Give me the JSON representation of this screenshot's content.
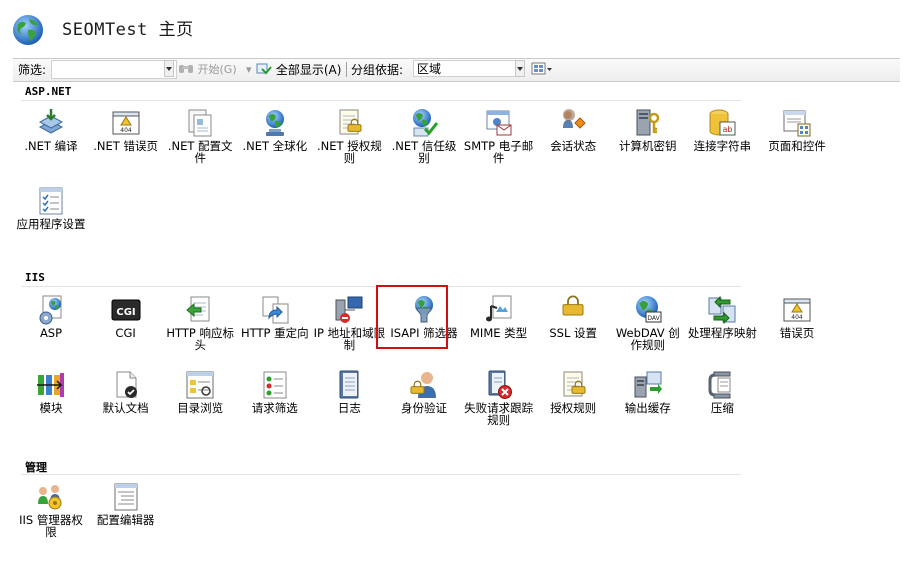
{
  "header": {
    "title": "SEOMTest 主页"
  },
  "toolbar": {
    "filter_label": "筛选:",
    "start_label": "开始(G)",
    "show_all_label": "全部显示(A)",
    "group_by_label": "分组依据:",
    "group_by_value": "区域"
  },
  "sections": [
    {
      "title": "ASP.NET",
      "items": [
        {
          "label": ".NET 编译",
          "icon": "compile-icon"
        },
        {
          "label": ".NET 错误页",
          "icon": "error-page-icon"
        },
        {
          "label": ".NET 配置文件",
          "icon": "profile-icon"
        },
        {
          "label": ".NET 全球化",
          "icon": "globalization-icon"
        },
        {
          "label": ".NET 授权规则",
          "icon": "authorization-icon"
        },
        {
          "label": ".NET 信任级别",
          "icon": "trust-level-icon"
        },
        {
          "label": "SMTP 电子邮件",
          "icon": "email-icon"
        },
        {
          "label": "会话状态",
          "icon": "session-state-icon"
        },
        {
          "label": "计算机密钥",
          "icon": "machine-key-icon"
        },
        {
          "label": "连接字符串",
          "icon": "connection-string-icon"
        },
        {
          "label": "页面和控件",
          "icon": "pages-controls-icon"
        },
        {
          "label": "应用程序设置",
          "icon": "app-settings-icon"
        }
      ]
    },
    {
      "title": "IIS",
      "items": [
        {
          "label": "ASP",
          "icon": "asp-icon"
        },
        {
          "label": "CGI",
          "icon": "cgi-icon"
        },
        {
          "label": "HTTP 响应标头",
          "icon": "response-headers-icon"
        },
        {
          "label": "HTTP 重定向",
          "icon": "redirect-icon"
        },
        {
          "label": "IP 地址和域限制",
          "icon": "ip-restrictions-icon"
        },
        {
          "label": "ISAPI 筛选器",
          "icon": "isapi-filter-icon"
        },
        {
          "label": "MIME 类型",
          "icon": "mime-types-icon"
        },
        {
          "label": "SSL 设置",
          "icon": "ssl-lock-icon"
        },
        {
          "label": "WebDAV 创作规则",
          "icon": "webdav-icon"
        },
        {
          "label": "处理程序映射",
          "icon": "handler-mappings-icon"
        },
        {
          "label": "错误页",
          "icon": "error-page-icon"
        },
        {
          "label": "模块",
          "icon": "modules-icon"
        },
        {
          "label": "默认文档",
          "icon": "default-document-icon"
        },
        {
          "label": "目录浏览",
          "icon": "directory-browsing-icon"
        },
        {
          "label": "请求筛选",
          "icon": "request-filtering-icon"
        },
        {
          "label": "日志",
          "icon": "logging-icon"
        },
        {
          "label": "身份验证",
          "icon": "authentication-icon"
        },
        {
          "label": "失败请求跟踪规则",
          "icon": "failed-request-icon"
        },
        {
          "label": "授权规则",
          "icon": "authorization-icon"
        },
        {
          "label": "输出缓存",
          "icon": "output-cache-icon"
        },
        {
          "label": "压缩",
          "icon": "compression-icon"
        }
      ]
    },
    {
      "title": "管理",
      "items": [
        {
          "label": "IIS 管理器权限",
          "icon": "manager-permissions-icon"
        },
        {
          "label": "配置编辑器",
          "icon": "config-editor-icon"
        }
      ]
    }
  ]
}
